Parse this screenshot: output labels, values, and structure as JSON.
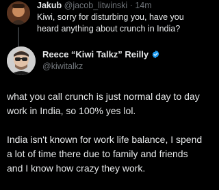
{
  "reply": {
    "name": "Jakub",
    "handle": "@jacob_litwinski",
    "separator": "·",
    "time": "14m",
    "text": "Kiwi, sorry for disturbing you, have you heard anything about crunch in India?"
  },
  "main": {
    "name": "Reece “Kiwi Talkz” Reilly",
    "handle": "@kiwitalkz",
    "verified_icon": "verified-badge-icon",
    "paragraph1": "what you call crunch is just normal day to day work in India, so 100% yes lol.",
    "paragraph2": "India isn't known for work life balance, I spend a lot of time there due to family and friends and I know how crazy they work."
  },
  "colors": {
    "background": "#000000",
    "text": "#e7e9ea",
    "secondary": "#71767b",
    "verified": "#1d9bf0"
  }
}
